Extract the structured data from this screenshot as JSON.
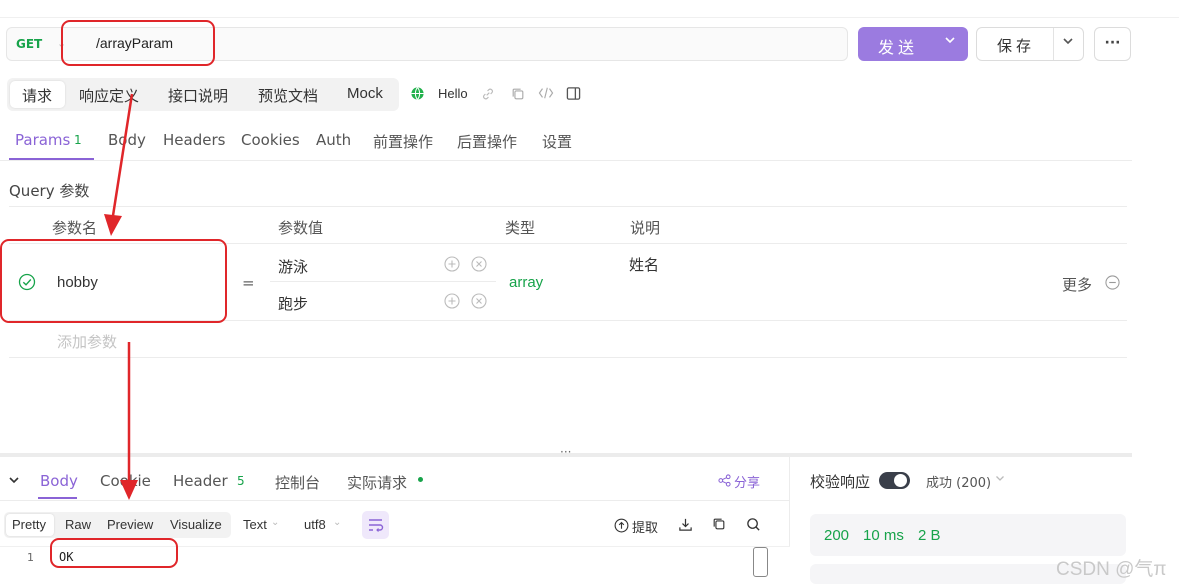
{
  "request": {
    "method": "GET",
    "path": "/arrayParam",
    "send_label": "发送",
    "save_label": "保存"
  },
  "sub_tabs": [
    "请求",
    "响应定义",
    "接口说明",
    "预览文档",
    "Mock"
  ],
  "env_name": "Hello",
  "param_tabs": {
    "params_label": "Params",
    "params_count": "1",
    "others": [
      "Body",
      "Headers",
      "Cookies",
      "Auth",
      "前置操作",
      "后置操作",
      "设置"
    ]
  },
  "query": {
    "title": "Query 参数",
    "headers": [
      "参数名",
      "参数值",
      "类型",
      "说明"
    ],
    "row": {
      "name": "hobby",
      "equals": "=",
      "values": [
        "游泳",
        "跑步"
      ],
      "type": "array",
      "description": "姓名",
      "more_label": "更多"
    },
    "add_placeholder": "添加参数"
  },
  "bottom_tabs": {
    "body": "Body",
    "cookie": "Cookie",
    "header": "Header",
    "header_count": "5",
    "console": "控制台",
    "actual_request": "实际请求",
    "share": "分享"
  },
  "response_format": {
    "modes": [
      "Pretty",
      "Raw",
      "Preview",
      "Visualize"
    ],
    "type": "Text",
    "encoding": "utf8",
    "extract_label": "提取"
  },
  "response_body": {
    "line_number": "1",
    "content": "OK"
  },
  "validation": {
    "label": "校验响应",
    "status_select": "成功 (200)"
  },
  "response_meta": {
    "status": "200",
    "time": "10 ms",
    "size": "2 B"
  },
  "watermark": "CSDN @气π",
  "colors": {
    "accent": "#8a63d6",
    "send_button": "#9b7be0",
    "method_get": "#17a34a",
    "annotation_red": "#e0262a"
  }
}
